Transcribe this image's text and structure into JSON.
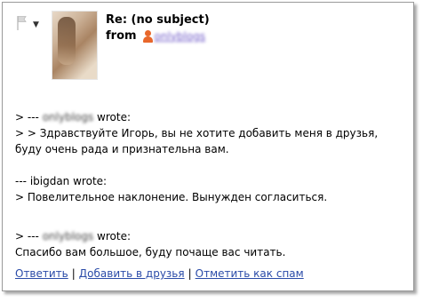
{
  "header": {
    "subject": "Re: (no subject)",
    "from_label": "from",
    "from_user": "onlyblogs"
  },
  "messages": [
    {
      "prefix": "> --- ",
      "author": "onlyblogs",
      "suffix": " wrote:"
    },
    {
      "line": "> > Здравствуйте Игорь, вы не хотите добавить меня в друзья,"
    },
    {
      "line": "буду очень рада и признательна вам."
    },
    {
      "prefix": "--- ",
      "author": "ibigdan",
      "suffix": " wrote:"
    },
    {
      "line": "> Повелительное наклонение. Вынужден согласиться."
    },
    {
      "prefix": "> --- ",
      "author": "onlyblogs",
      "suffix": " wrote:"
    },
    {
      "line": "Спасибо вам большое, буду почаще вас читать."
    }
  ],
  "actions": {
    "reply": "Ответить",
    "add_friend": "Добавить в друзья",
    "mark_spam": "Отметить как спам",
    "separator": "|"
  },
  "icons": {
    "flag": "flag-icon",
    "caret": "chevron-down-icon",
    "user": "user-icon"
  },
  "colors": {
    "link": "#2a4ba8",
    "user_link": "#6d57c7",
    "user_icon": "#e8672b"
  }
}
